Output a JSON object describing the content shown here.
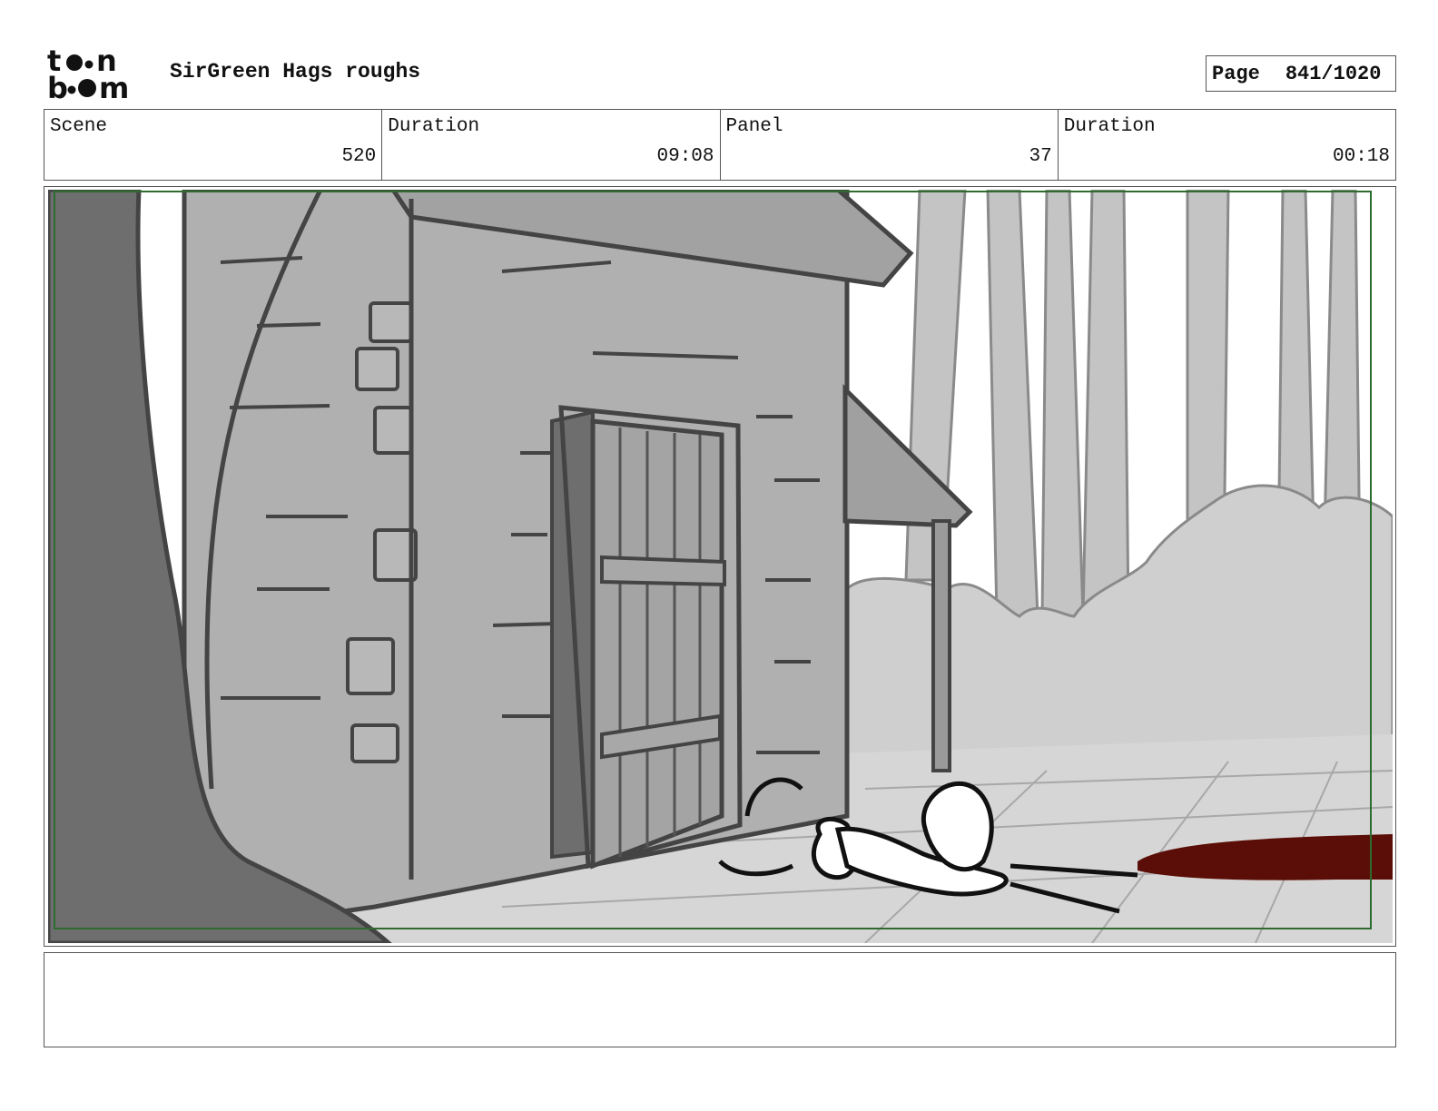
{
  "header": {
    "logo_top": "to•n",
    "logo_bottom": "b•om",
    "project_title": "SirGreen Hags roughs",
    "page_label": "Page",
    "page_value": "841/1020"
  },
  "info": {
    "scene_label": "Scene",
    "scene_value": "520",
    "scene_duration_label": "Duration",
    "scene_duration_value": "09:08",
    "panel_label": "Panel",
    "panel_value": "37",
    "panel_duration_label": "Duration",
    "panel_duration_value": "00:18"
  },
  "notes": {
    "text": ""
  },
  "colors": {
    "safe_area": "#2e6b2e",
    "blood": "#5a0e07",
    "stone": "#b0b0b0",
    "tree": "#6e6e6e",
    "background_trees": "#c4c4c4"
  }
}
